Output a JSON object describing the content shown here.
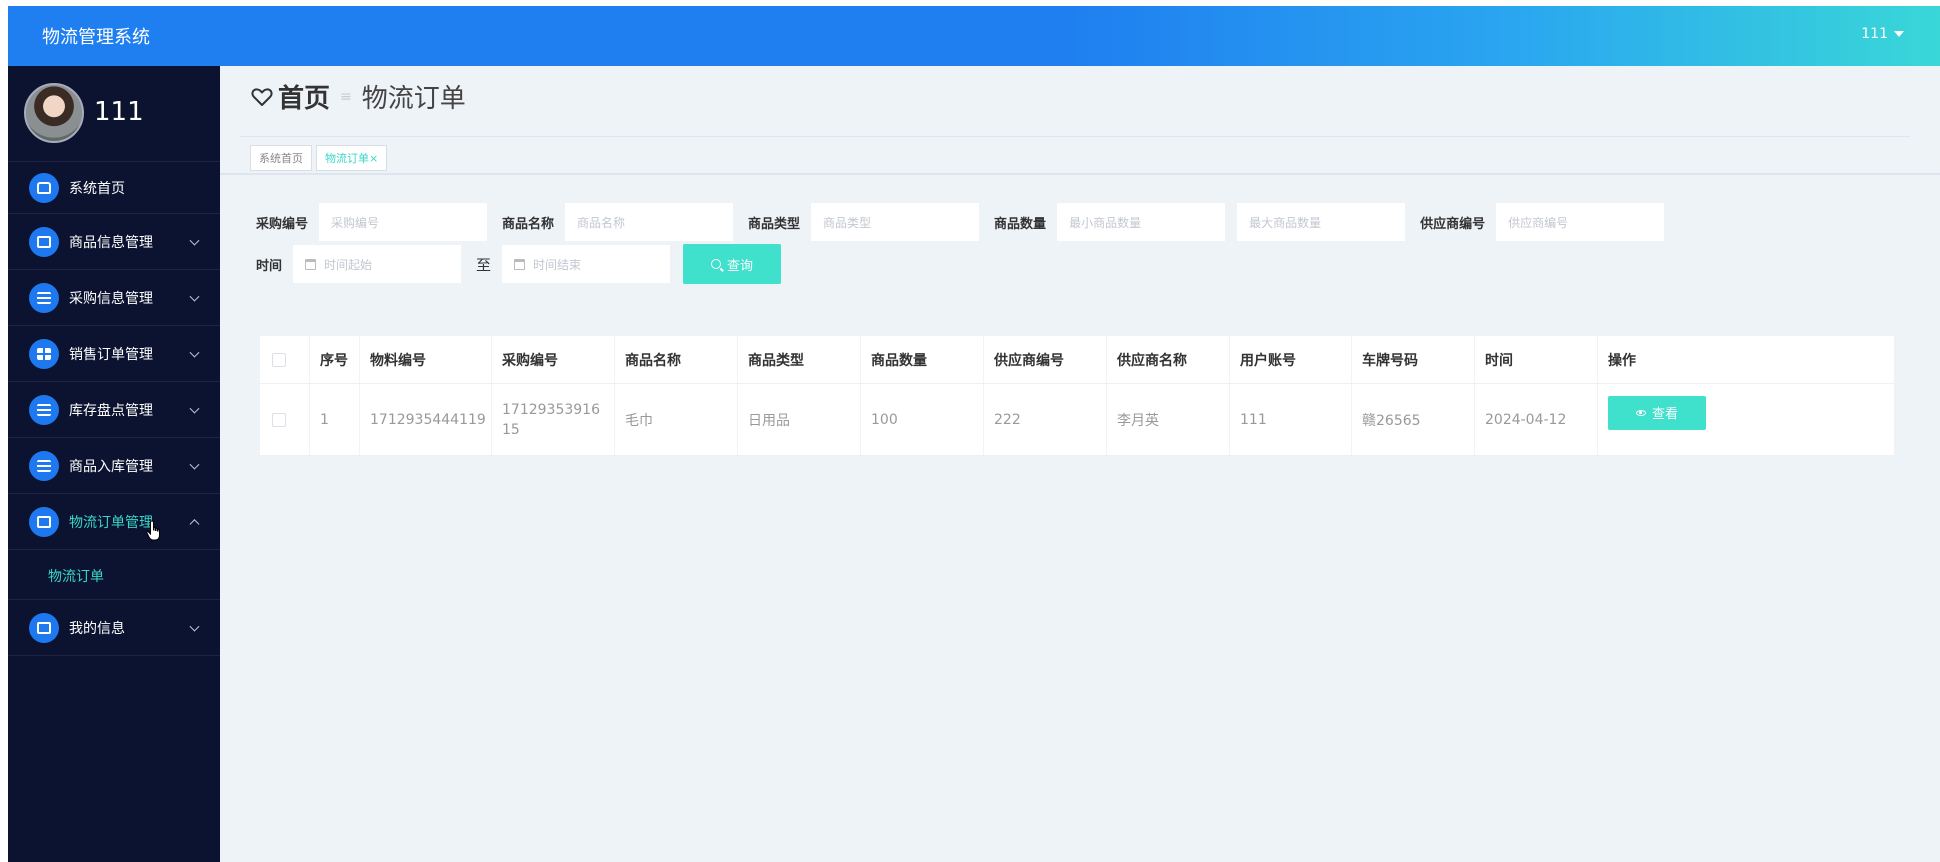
{
  "header": {
    "app_title": "物流管理系统",
    "user_menu": "111"
  },
  "sidebar": {
    "profile_name": "111",
    "items": [
      {
        "label": "系统首页",
        "icon": "home-icon",
        "expandable": false
      },
      {
        "label": "商品信息管理",
        "icon": "goods-icon",
        "expandable": true
      },
      {
        "label": "采购信息管理",
        "icon": "purchase-icon",
        "expandable": true
      },
      {
        "label": "销售订单管理",
        "icon": "grid-icon",
        "expandable": true
      },
      {
        "label": "库存盘点管理",
        "icon": "list-icon",
        "expandable": true
      },
      {
        "label": "商品入库管理",
        "icon": "sliders-icon",
        "expandable": true
      },
      {
        "label": "物流订单管理",
        "icon": "truck-icon",
        "expandable": true,
        "expanded": true
      },
      {
        "label": "我的信息",
        "icon": "card-icon",
        "expandable": true
      }
    ],
    "submenu": {
      "label": "物流订单"
    },
    "accent_color": "#39d7c8",
    "bg_color": "#0b1330"
  },
  "page": {
    "home_title": "首页",
    "separator": "≡",
    "current": "物流订单",
    "tabs": [
      {
        "label": "系统首页",
        "active": false
      },
      {
        "label": "物流订单×",
        "active": true
      }
    ]
  },
  "filters": {
    "purchase_no": {
      "label": "采购编号",
      "placeholder": "采购编号"
    },
    "goods_name": {
      "label": "商品名称",
      "placeholder": "商品名称"
    },
    "goods_type": {
      "label": "商品类型",
      "placeholder": "商品类型"
    },
    "goods_qty": {
      "label": "商品数量",
      "min_placeholder": "最小商品数量",
      "max_placeholder": "最大商品数量"
    },
    "supplier_no": {
      "label": "供应商编号",
      "placeholder": "供应商编号"
    },
    "time": {
      "label": "时间",
      "start_placeholder": "时间起始",
      "to": "至",
      "end_placeholder": "时间结束"
    },
    "query_button": "查询"
  },
  "table": {
    "columns": [
      "序号",
      "物料编号",
      "采购编号",
      "商品名称",
      "商品类型",
      "商品数量",
      "供应商编号",
      "供应商名称",
      "用户账号",
      "车牌号码",
      "时间",
      "操作"
    ],
    "rows": [
      [
        "1",
        "1712935444119",
        "1712935391615",
        "毛巾",
        "日用品",
        "100",
        "222",
        "李月英",
        "111",
        "赣26565",
        "2024-04-12"
      ]
    ],
    "view_button": "查看"
  },
  "theme": {
    "primary_blue": "#1f7ff0",
    "teal": "#3fe0cc"
  }
}
